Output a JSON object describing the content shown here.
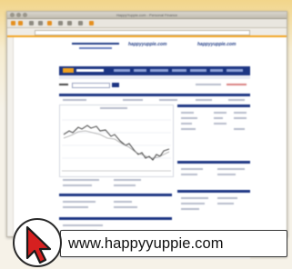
{
  "colors": {
    "accent_orange": "#f2a21e",
    "brand_navy": "#1c3583",
    "cursor_red": "#d62020"
  },
  "browser": {
    "title": "HappyYuppie.com - Personal Finance"
  },
  "site": {
    "logo_left": "happyyuppie.com",
    "logo_right": "happyyuppie.com"
  },
  "icons": {
    "cursor": "mouse-pointer-icon"
  },
  "caption": {
    "url": "www.happyyuppie.com"
  }
}
